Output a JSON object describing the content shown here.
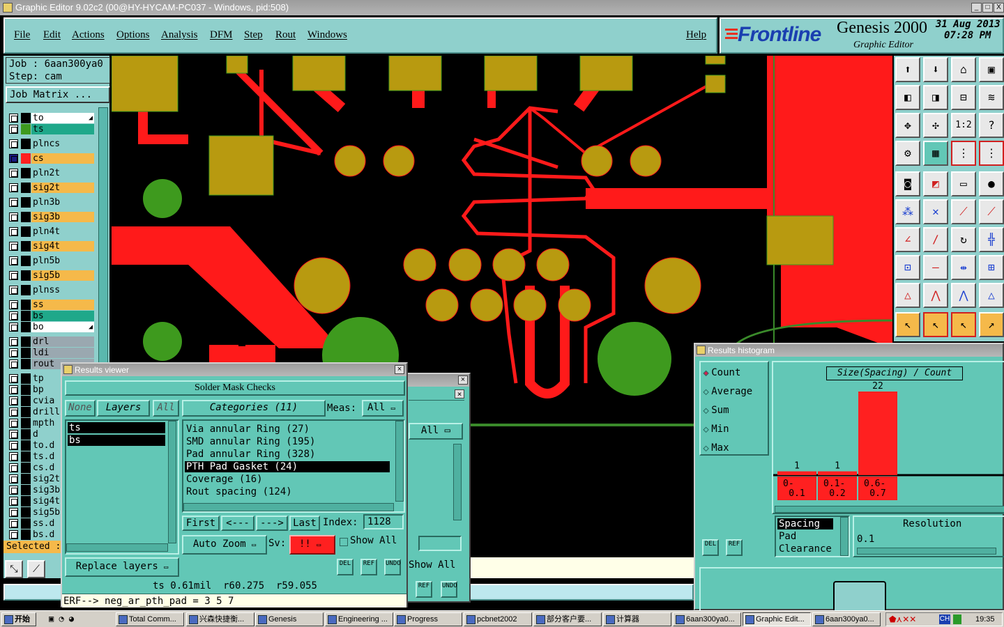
{
  "window": {
    "title": "Graphic Editor 9.02c2 (00@HY-HYCAM-PC037 - Windows, pid:508)",
    "buttons": [
      "_",
      "□",
      "X"
    ]
  },
  "menu": {
    "items": [
      "File",
      "Edit",
      "Actions",
      "Options",
      "Analysis",
      "DFM",
      "Step",
      "Rout",
      "Windows"
    ],
    "help": "Help"
  },
  "header": {
    "brand": "Frontline",
    "product": "Genesis 2000",
    "subtitle": "Graphic Editor",
    "date": "31 Aug 2013",
    "time": "07:28 PM"
  },
  "job": {
    "job_label": "Job : 6aan300ya0",
    "step_label": "Step: cam",
    "job_matrix": "Job Matrix ..."
  },
  "layers": [
    {
      "name": "to",
      "color": "#ffffff",
      "swatch": "#000000",
      "checked": false,
      "arrow": true
    },
    {
      "name": "ts",
      "color": "#1fa88a",
      "swatch": "#3e9a1e",
      "checked": false
    },
    {
      "name": "plncs",
      "color": "#8fd0cc",
      "swatch": "#000000",
      "checked": false
    },
    {
      "name": "cs",
      "color": "#f5b94a",
      "swatch": "#ff2020",
      "checked": true
    },
    {
      "name": "pln2t",
      "color": "#8fd0cc",
      "swatch": "#000000",
      "checked": false
    },
    {
      "name": "sig2t",
      "color": "#f5b94a",
      "swatch": "#000000",
      "checked": false
    },
    {
      "name": "pln3b",
      "color": "#8fd0cc",
      "swatch": "#000000",
      "checked": false
    },
    {
      "name": "sig3b",
      "color": "#f5b94a",
      "swatch": "#000000",
      "checked": false
    },
    {
      "name": "pln4t",
      "color": "#8fd0cc",
      "swatch": "#000000",
      "checked": false
    },
    {
      "name": "sig4t",
      "color": "#f5b94a",
      "swatch": "#000000",
      "checked": false
    },
    {
      "name": "pln5b",
      "color": "#8fd0cc",
      "swatch": "#000000",
      "checked": false
    },
    {
      "name": "sig5b",
      "color": "#f5b94a",
      "swatch": "#000000",
      "checked": false
    },
    {
      "name": "plnss",
      "color": "#8fd0cc",
      "swatch": "#000000",
      "checked": false
    },
    {
      "name": "ss",
      "color": "#f5b94a",
      "swatch": "#000000",
      "checked": false
    },
    {
      "name": "bs",
      "color": "#1fa88a",
      "swatch": "#000000",
      "checked": false
    },
    {
      "name": "bo",
      "color": "#ffffff",
      "swatch": "#000000",
      "checked": false,
      "arrow": true
    },
    {
      "name": "drl",
      "color": "#9aa8b0",
      "swatch": "#000000",
      "checked": false
    },
    {
      "name": "ldi",
      "color": "#9aa8b0",
      "swatch": "#000000",
      "checked": false
    },
    {
      "name": "rout",
      "color": "#9aa8b0",
      "swatch": "#000000",
      "checked": false
    },
    {
      "name": "tp",
      "color": "#8fd0cc",
      "swatch": "#000000",
      "checked": false
    },
    {
      "name": "bp",
      "color": "#8fd0cc",
      "swatch": "#000000",
      "checked": false
    },
    {
      "name": "cvia",
      "color": "#8fd0cc",
      "swatch": "#000000",
      "checked": false
    },
    {
      "name": "drill",
      "color": "#8fd0cc",
      "swatch": "#000000",
      "checked": false
    },
    {
      "name": "mpth",
      "color": "#8fd0cc",
      "swatch": "#000000",
      "checked": false
    },
    {
      "name": "d",
      "color": "#8fd0cc",
      "swatch": "#000000",
      "checked": false
    },
    {
      "name": "to.d",
      "color": "#8fd0cc",
      "swatch": "#000000",
      "checked": false
    },
    {
      "name": "ts.d",
      "color": "#8fd0cc",
      "swatch": "#000000",
      "checked": false
    },
    {
      "name": "cs.d",
      "color": "#8fd0cc",
      "swatch": "#000000",
      "checked": false
    },
    {
      "name": "sig2t",
      "color": "#8fd0cc",
      "swatch": "#000000",
      "checked": false
    },
    {
      "name": "sig3b",
      "color": "#8fd0cc",
      "swatch": "#000000",
      "checked": false
    },
    {
      "name": "sig4t",
      "color": "#8fd0cc",
      "swatch": "#000000",
      "checked": false
    },
    {
      "name": "sig5b",
      "color": "#8fd0cc",
      "swatch": "#000000",
      "checked": false
    },
    {
      "name": "ss.d",
      "color": "#8fd0cc",
      "swatch": "#000000",
      "checked": false
    },
    {
      "name": "bs.d",
      "color": "#8fd0cc",
      "swatch": "#000000",
      "checked": false
    }
  ],
  "selected_label": "Selected :",
  "results_viewer": {
    "title": "Results viewer",
    "heading": "Solder Mask Checks",
    "none_btn": "None",
    "layers_btn": "Layers",
    "all_btn": "All",
    "categories_btn": "Categories (11)",
    "meas_label": "Meas:",
    "meas_value": "All",
    "layer_list": [
      "ts",
      "bs"
    ],
    "categories": [
      "Via annular Ring (27)",
      "SMD annular Ring (195)",
      "Pad annular Ring (328)",
      "PTH Pad Gasket (24)",
      "Coverage (16)",
      "Rout spacing (124)"
    ],
    "selected_category": 3,
    "nav": {
      "first": "First",
      "prev": "<---",
      "next": "--->",
      "last": "Last",
      "index_label": "Index:",
      "index_value": "1128"
    },
    "auto_zoom": "Auto Zoom",
    "sv_label": "Sv:",
    "sv_value": "!!",
    "show_all": "Show All",
    "replace_layers": "Replace layers",
    "icon_btns": [
      "DEL",
      "REF",
      "UNDO"
    ],
    "status": "ts 0.61mil  r60.275  r59.055",
    "erf": "ERF--> neg_ar_pth_pad = 3 5 7"
  },
  "behind_dialog": {
    "all_value": "All",
    "show_all": "Show All",
    "icon_btns": [
      "REF",
      "UNDO"
    ]
  },
  "histogram": {
    "title": "Results histogram",
    "options": [
      "Count",
      "Average",
      "Sum",
      "Min",
      "Max"
    ],
    "selected_option": 0,
    "chart_title": "Size(Spacing) / Count",
    "icon_btns": [
      "DEL",
      "REF"
    ],
    "attr_list": [
      "Spacing",
      "Pad",
      "Clearance"
    ],
    "selected_attr": 0,
    "resolution_label": "Resolution",
    "resolution_value": "0.1"
  },
  "chart_data": {
    "type": "bar",
    "title": "Size(Spacing) / Count",
    "categories": [
      "0-0.1",
      "0.1-0.2",
      "0.6-0.7"
    ],
    "category_labels": [
      [
        "0-",
        "0.1"
      ],
      [
        "0.1-",
        "0.2"
      ],
      [
        "0.6-",
        "0.7"
      ]
    ],
    "values": [
      1,
      1,
      22
    ],
    "bar_color": "#ff2020",
    "ylim": [
      0,
      22
    ]
  },
  "taskbar": {
    "start": "开始",
    "tasks": [
      "Total Comm...",
      "兴森快捷衡...",
      "Genesis",
      "Engineering ...",
      "Progress",
      "pcbnet2002",
      "部分客户要...",
      "计算器",
      "6aan300ya0...",
      "Graphic Edit...",
      "6aan300ya0..."
    ],
    "active_task": 9,
    "tray_lang": "CH",
    "clock": "19:35"
  }
}
